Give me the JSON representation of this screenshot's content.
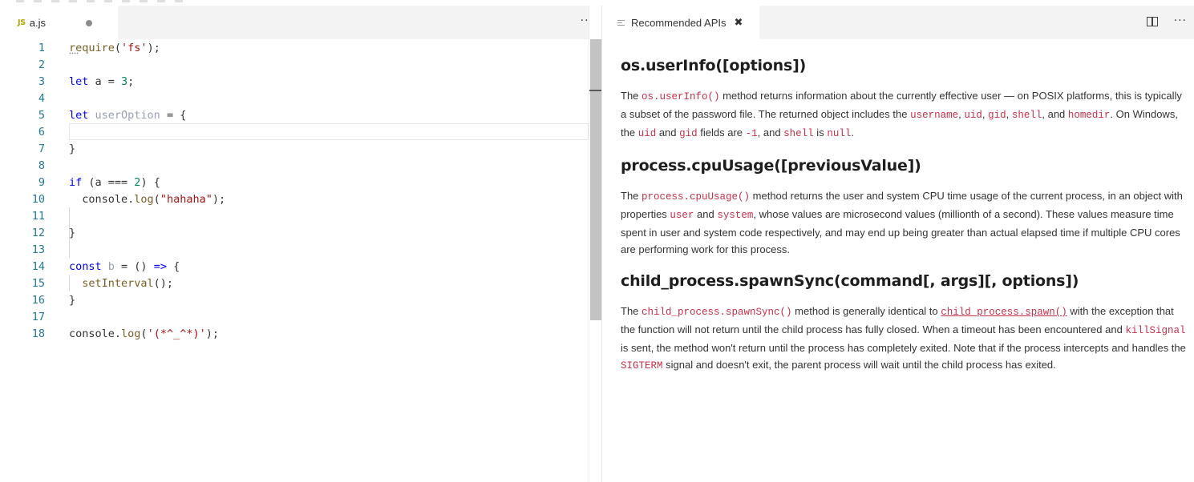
{
  "editor": {
    "tab": {
      "icon_text": "JS",
      "filename": "a.js"
    },
    "more_label": "···",
    "lines": [
      {
        "n": "1",
        "tokens": [
          {
            "t": "fn",
            "v": "require"
          },
          {
            "t": "plain",
            "v": "("
          },
          {
            "t": "str",
            "v": "'fs'"
          },
          {
            "t": "plain",
            "v": ");"
          }
        ]
      },
      {
        "n": "2",
        "tokens": []
      },
      {
        "n": "3",
        "tokens": [
          {
            "t": "kw",
            "v": "let"
          },
          {
            "t": "plain",
            "v": " a = "
          },
          {
            "t": "num",
            "v": "3"
          },
          {
            "t": "plain",
            "v": ";"
          }
        ]
      },
      {
        "n": "4",
        "tokens": []
      },
      {
        "n": "5",
        "tokens": [
          {
            "t": "kw",
            "v": "let"
          },
          {
            "t": "plain",
            "v": " "
          },
          {
            "t": "dim",
            "v": "userOption"
          },
          {
            "t": "plain",
            "v": " = {"
          }
        ]
      },
      {
        "n": "6",
        "tokens": []
      },
      {
        "n": "7",
        "tokens": [
          {
            "t": "plain",
            "v": "}"
          }
        ]
      },
      {
        "n": "8",
        "tokens": []
      },
      {
        "n": "9",
        "tokens": [
          {
            "t": "kw",
            "v": "if"
          },
          {
            "t": "plain",
            "v": " (a === "
          },
          {
            "t": "num",
            "v": "2"
          },
          {
            "t": "plain",
            "v": ") {"
          }
        ]
      },
      {
        "n": "10",
        "tokens": [
          {
            "t": "plain",
            "v": "  console."
          },
          {
            "t": "fn",
            "v": "log"
          },
          {
            "t": "plain",
            "v": "("
          },
          {
            "t": "str",
            "v": "\"hahaha\""
          },
          {
            "t": "plain",
            "v": ");"
          }
        ]
      },
      {
        "n": "11",
        "tokens": []
      },
      {
        "n": "12",
        "tokens": [
          {
            "t": "plain",
            "v": "}"
          }
        ]
      },
      {
        "n": "13",
        "tokens": []
      },
      {
        "n": "14",
        "tokens": [
          {
            "t": "kw",
            "v": "const"
          },
          {
            "t": "plain",
            "v": " "
          },
          {
            "t": "dim",
            "v": "b"
          },
          {
            "t": "plain",
            "v": " = () "
          },
          {
            "t": "kw",
            "v": "=>"
          },
          {
            "t": "plain",
            "v": " {"
          }
        ]
      },
      {
        "n": "15",
        "tokens": [
          {
            "t": "plain",
            "v": "  "
          },
          {
            "t": "fn",
            "v": "setInterval"
          },
          {
            "t": "plain",
            "v": "();"
          }
        ]
      },
      {
        "n": "16",
        "tokens": [
          {
            "t": "plain",
            "v": "}"
          }
        ]
      },
      {
        "n": "17",
        "tokens": []
      },
      {
        "n": "18",
        "tokens": [
          {
            "t": "plain",
            "v": "console."
          },
          {
            "t": "fn",
            "v": "log"
          },
          {
            "t": "plain",
            "v": "("
          },
          {
            "t": "str",
            "v": "'(*^_^*)'"
          },
          {
            "t": "plain",
            "v": ");"
          }
        ]
      }
    ],
    "current_line": "6"
  },
  "panel": {
    "tab_label": "Recommended APIs",
    "close_label": "✖",
    "split_icon": "split-editor-icon",
    "more_label": "···",
    "sections": [
      {
        "title": "os.userInfo([options])",
        "body": [
          {
            "t": "text",
            "v": "The "
          },
          {
            "t": "code",
            "v": "os.userInfo()"
          },
          {
            "t": "text",
            "v": " method returns information about the currently effective user — on POSIX platforms, this is typically a subset of the password file. The returned object includes the "
          },
          {
            "t": "code",
            "v": "username"
          },
          {
            "t": "text",
            "v": ", "
          },
          {
            "t": "code",
            "v": "uid"
          },
          {
            "t": "text",
            "v": ", "
          },
          {
            "t": "code",
            "v": "gid"
          },
          {
            "t": "text",
            "v": ", "
          },
          {
            "t": "code",
            "v": "shell"
          },
          {
            "t": "text",
            "v": ", and "
          },
          {
            "t": "code",
            "v": "homedir"
          },
          {
            "t": "text",
            "v": ". On Windows, the "
          },
          {
            "t": "code",
            "v": "uid"
          },
          {
            "t": "text",
            "v": " and "
          },
          {
            "t": "code",
            "v": "gid"
          },
          {
            "t": "text",
            "v": " fields are "
          },
          {
            "t": "code",
            "v": "-1"
          },
          {
            "t": "text",
            "v": ", and "
          },
          {
            "t": "code",
            "v": "shell"
          },
          {
            "t": "text",
            "v": " is "
          },
          {
            "t": "code",
            "v": "null"
          },
          {
            "t": "text",
            "v": "."
          }
        ]
      },
      {
        "title": "process.cpuUsage([previousValue])",
        "body": [
          {
            "t": "text",
            "v": "The "
          },
          {
            "t": "code",
            "v": "process.cpuUsage()"
          },
          {
            "t": "text",
            "v": " method returns the user and system CPU time usage of the current process, in an object with properties "
          },
          {
            "t": "code",
            "v": "user"
          },
          {
            "t": "text",
            "v": " and "
          },
          {
            "t": "code",
            "v": "system"
          },
          {
            "t": "text",
            "v": ", whose values are microsecond values (millionth of a second). These values measure time spent in user and system code respectively, and may end up being greater than actual elapsed time if multiple CPU cores are performing work for this process."
          }
        ]
      },
      {
        "title": "child_process.spawnSync(command[, args][, options])",
        "body": [
          {
            "t": "text",
            "v": "The "
          },
          {
            "t": "code",
            "v": "child_process.spawnSync()"
          },
          {
            "t": "text",
            "v": " method is generally identical to "
          },
          {
            "t": "link",
            "v": "child_process.spawn()"
          },
          {
            "t": "text",
            "v": " with the exception that the function will not return until the child process has fully closed. When a timeout has been encountered and "
          },
          {
            "t": "code",
            "v": "killSignal"
          },
          {
            "t": "text",
            "v": " is sent, the method won't return until the process has completely exited. Note that if the process intercepts and handles the "
          },
          {
            "t": "code",
            "v": "SIGTERM"
          },
          {
            "t": "text",
            "v": " signal and doesn't exit, the parent process will wait until the child process has exited."
          }
        ]
      }
    ]
  }
}
